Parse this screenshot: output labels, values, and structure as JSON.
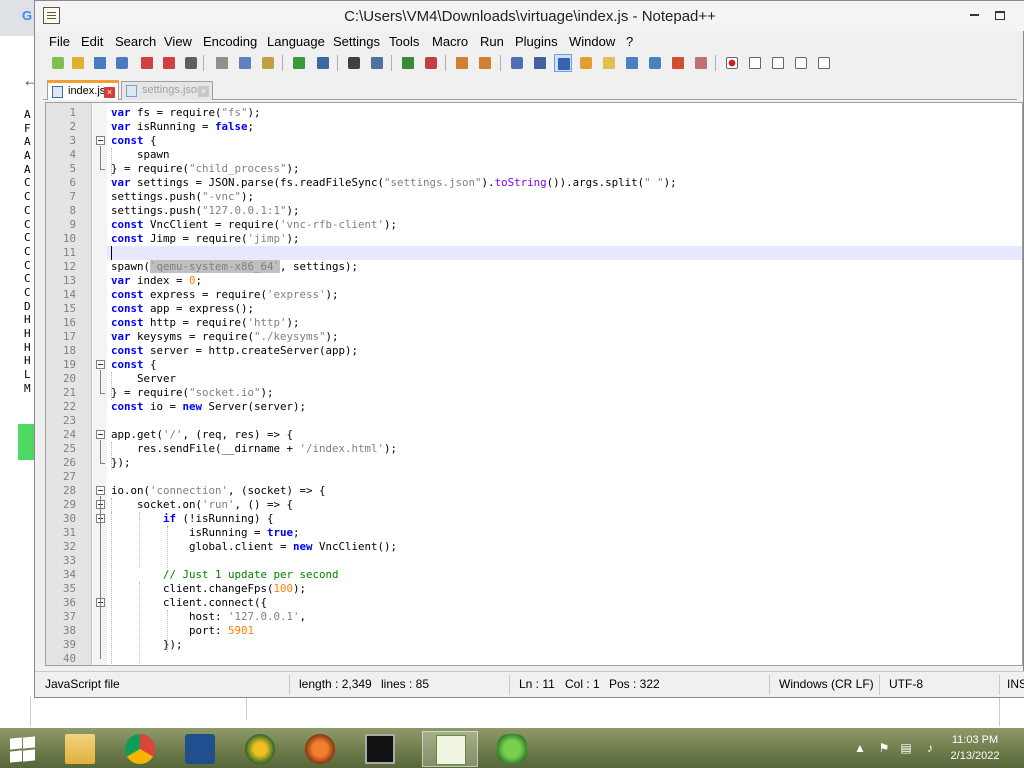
{
  "window": {
    "title": "C:\\Users\\VM4\\Downloads\\virtuage\\index.js - Notepad++"
  },
  "menu": [
    "File",
    "Edit",
    "Search",
    "View",
    "Encoding",
    "Language",
    "Settings",
    "Tools",
    "Macro",
    "Run",
    "Plugins",
    "Window",
    "?"
  ],
  "tabs": [
    {
      "label": "index.js",
      "active": true
    },
    {
      "label": "settings.json",
      "active": false
    }
  ],
  "toolbar_icons": [
    "new-file-icon",
    "open-file-icon",
    "save-icon",
    "save-all-icon",
    "close-icon",
    "close-all-icon",
    "print-icon",
    "cut-icon",
    "copy-icon",
    "paste-icon",
    "undo-icon",
    "redo-icon",
    "find-icon",
    "replace-icon",
    "zoom-in-icon",
    "zoom-out-icon",
    "sync-vertical-icon",
    "sync-horizontal-icon",
    "word-wrap-icon",
    "show-all-chars-icon",
    "indent-guide-icon",
    "user-language-icon",
    "doc-map-icon",
    "doc-list-icon",
    "function-list-icon",
    "folder-workspace-icon",
    "monitoring-icon",
    "record-macro-icon",
    "stop-macro-icon",
    "play-macro-icon",
    "run-macro-multiple-icon",
    "save-macro-icon"
  ],
  "editor": {
    "current_line": 11,
    "highlight_text": "`qemu-system-x86_64`",
    "lines": [
      "var fs = require(\"fs\");",
      "var isRunning = false;",
      "const {",
      "    spawn",
      "} = require(\"child_process\");",
      "var settings = JSON.parse(fs.readFileSync(\"settings.json\").toString()).args.split(\" \");",
      "settings.push(\"-vnc\");",
      "settings.push(\"127.0.0.1:1\");",
      "const VncClient = require('vnc-rfb-client');",
      "const Jimp = require('jimp');",
      "",
      "spawn(`qemu-system-x86_64`, settings);",
      "var index = 0;",
      "const express = require('express');",
      "const app = express();",
      "const http = require('http');",
      "var keysyms = require(\"./keysyms\");",
      "const server = http.createServer(app);",
      "const {",
      "    Server",
      "} = require(\"socket.io\");",
      "const io = new Server(server);",
      "",
      "app.get('/', (req, res) => {",
      "    res.sendFile(__dirname + '/index.html');",
      "});",
      "",
      "io.on('connection', (socket) => {",
      "    socket.on('run', () => {",
      "        if (!isRunning) {",
      "            isRunning = true;",
      "            global.client = new VncClient();",
      "",
      "        // Just 1 update per second",
      "        client.changeFps(100);",
      "        client.connect({",
      "            host: '127.0.0.1',",
      "            port: 5901",
      "        });",
      ""
    ]
  },
  "status": {
    "language": "JavaScript file",
    "length": "length : 2,349",
    "lines": "lines : 85",
    "ln": "Ln : 11",
    "col": "Col : 1",
    "pos": "Pos : 322",
    "eol": "Windows (CR LF)",
    "encoding": "UTF-8",
    "mode": "INS"
  },
  "taskbar": {
    "apps": [
      "file-explorer-icon",
      "chrome-icon",
      "app-bird-icon",
      "app-globe-icon",
      "app-orb-icon",
      "command-prompt-icon",
      "notepad-plus-plus-icon",
      "app-frog-icon"
    ],
    "active_app": "notepad-plus-plus-icon",
    "time": "11:03 PM",
    "date": "2/13/2022"
  },
  "background": {
    "tab_letter": "G",
    "list_letters": [
      "A",
      "F",
      "A",
      "A",
      "A",
      "C",
      "C",
      "C",
      "C",
      "C",
      "C",
      "C",
      "C",
      "C",
      "D",
      "H",
      "H",
      "H",
      "H",
      "L",
      "M"
    ]
  }
}
